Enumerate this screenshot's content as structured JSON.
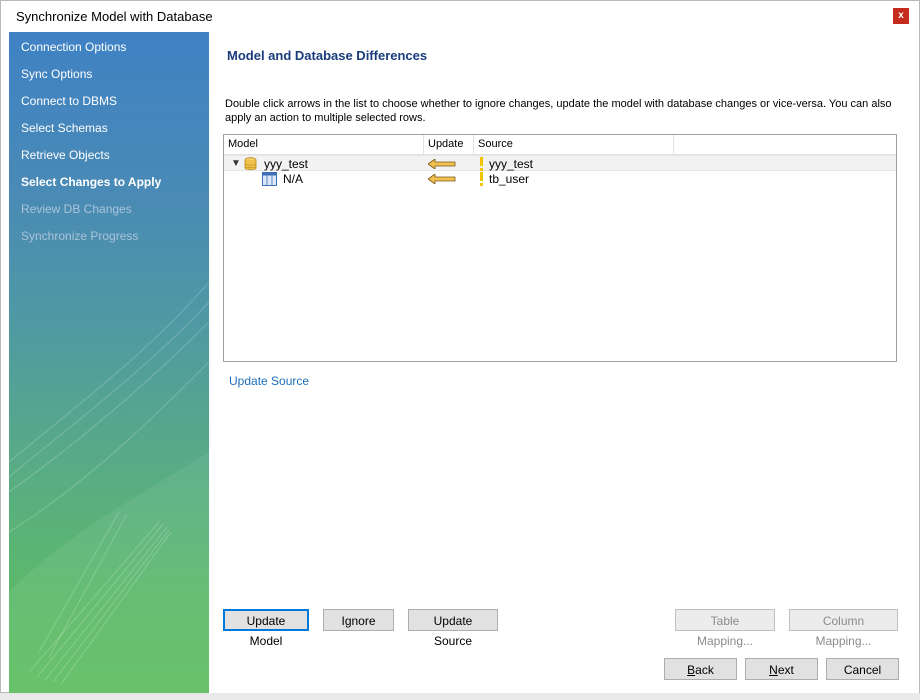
{
  "window": {
    "title": "Synchronize Model with Database",
    "close_label": "x"
  },
  "sidebar": {
    "items": [
      {
        "label": "Connection Options",
        "state": "normal"
      },
      {
        "label": "Sync Options",
        "state": "normal"
      },
      {
        "label": "Connect to DBMS",
        "state": "normal"
      },
      {
        "label": "Select Schemas",
        "state": "normal"
      },
      {
        "label": "Retrieve Objects",
        "state": "normal"
      },
      {
        "label": "Select Changes to Apply",
        "state": "active"
      },
      {
        "label": "Review DB Changes",
        "state": "disabled"
      },
      {
        "label": "Synchronize Progress",
        "state": "disabled"
      }
    ]
  },
  "main": {
    "heading": "Model and Database Differences",
    "description": "Double click arrows in the list to choose whether to ignore changes, update the model with database changes or vice-versa. You can also apply an action to multiple selected rows.",
    "tree": {
      "columns": [
        "Model",
        "Update",
        "Source"
      ],
      "rows": [
        {
          "model": "yyy_test",
          "model_icon": "database-icon",
          "action_icon": "arrow-left-icon",
          "source_icon": "exclamation-icon",
          "source": "yyy_test",
          "expanded": true
        },
        {
          "model": "N/A",
          "model_icon": "table-icon",
          "action_icon": "arrow-left-icon",
          "source_icon": "exclamation-icon",
          "source": "tb_user"
        }
      ]
    },
    "action_link": "Update Source"
  },
  "buttons": {
    "update_model": "Update Model",
    "ignore": "Ignore",
    "update_source": "Update Source",
    "table_mapping": "Table Mapping...",
    "column_mapping": "Column Mapping...",
    "back_first": "B",
    "back_rest": "ack",
    "next_first": "N",
    "next_rest": "ext",
    "cancel": "Cancel"
  },
  "colors": {
    "heading": "#1a3c7c",
    "link": "#1f6fb8",
    "arrow_fill": "#f0c050",
    "warning": "#f5c400",
    "close": "#c42b1c"
  }
}
